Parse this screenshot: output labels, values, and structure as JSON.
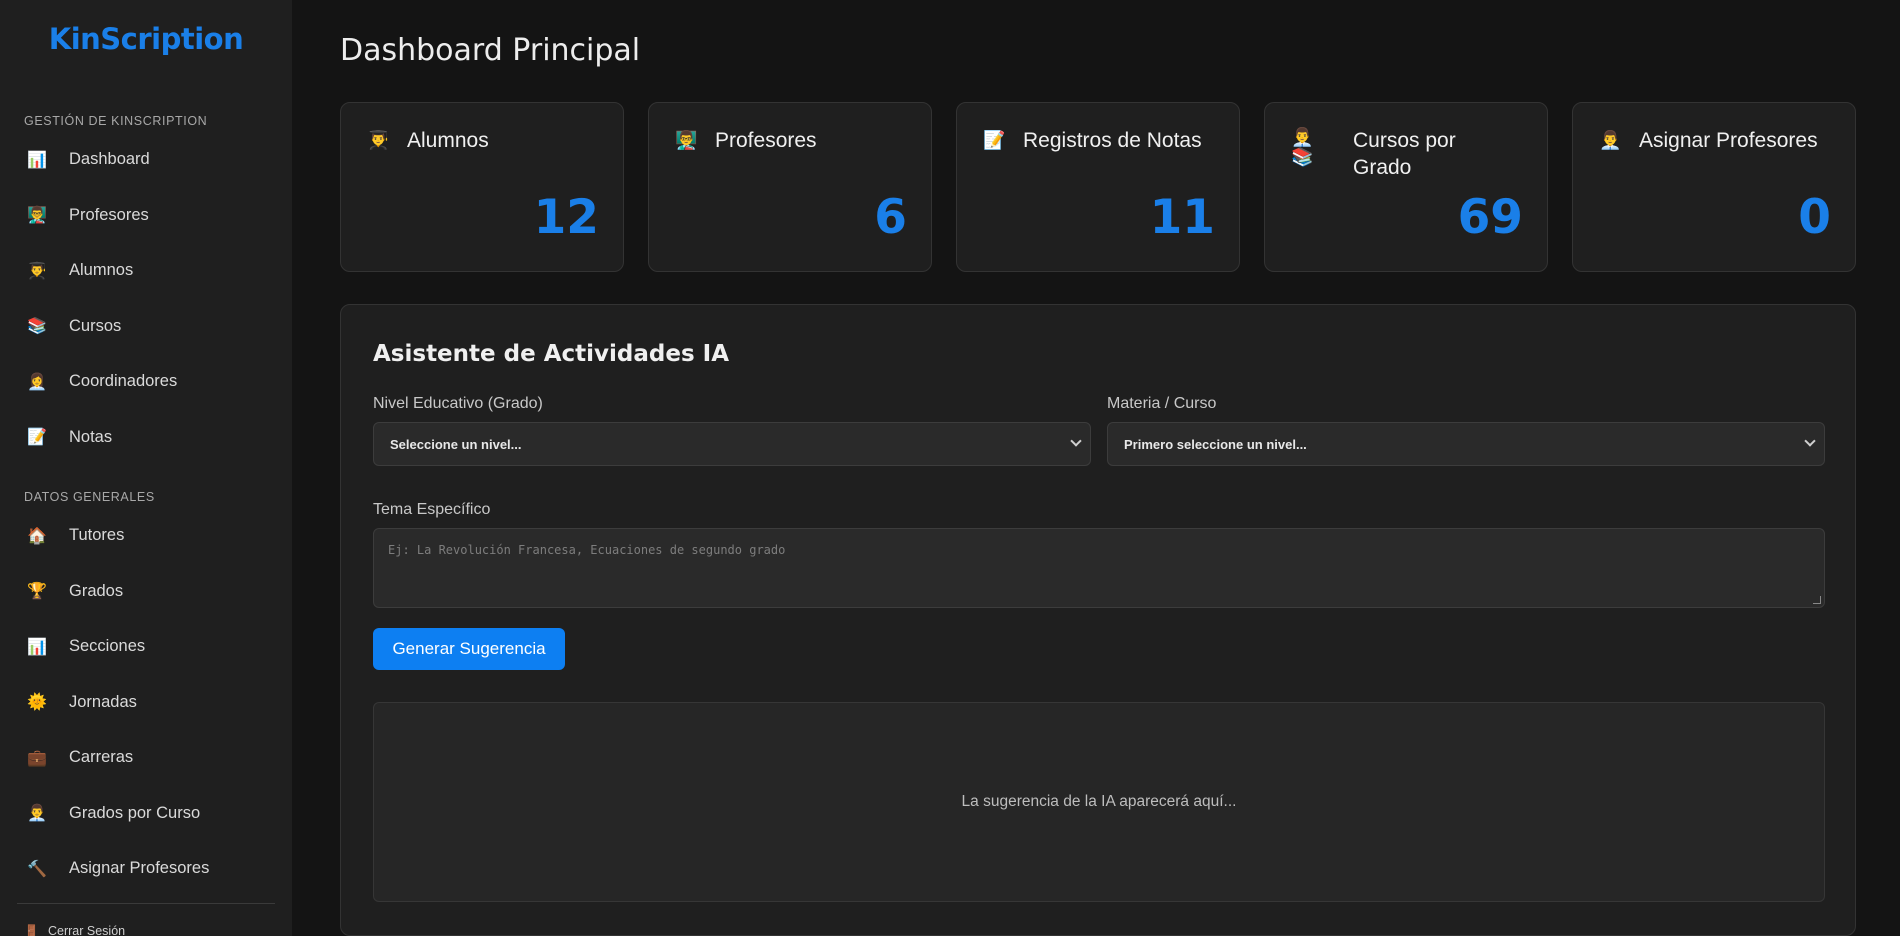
{
  "app": {
    "name": "KinScription",
    "accent": "#1a7fe8"
  },
  "sidebar": {
    "section1": "GESTIÓN DE KINSCRIPTION",
    "section2": "DATOS GENERALES",
    "items1": [
      {
        "label": "Dashboard",
        "icon": "📊"
      },
      {
        "label": "Profesores",
        "icon": "👨‍🏫"
      },
      {
        "label": "Alumnos",
        "icon": "👨‍🎓"
      },
      {
        "label": "Cursos",
        "icon": "📚"
      },
      {
        "label": "Coordinadores",
        "icon": "👩‍💼"
      },
      {
        "label": "Notas",
        "icon": "📝"
      }
    ],
    "items2": [
      {
        "label": "Tutores",
        "icon": "🏠"
      },
      {
        "label": "Grados",
        "icon": "🏆"
      },
      {
        "label": "Secciones",
        "icon": "📊"
      },
      {
        "label": "Jornadas",
        "icon": "🌞"
      },
      {
        "label": "Carreras",
        "icon": "💼"
      },
      {
        "label": "Grados por Curso",
        "icon": "👨‍💼"
      },
      {
        "label": "Asignar Profesores",
        "icon": "🔨"
      }
    ],
    "logout": {
      "label": "Cerrar Sesión",
      "icon": "🚪"
    }
  },
  "main": {
    "title": "Dashboard Principal",
    "cards": [
      {
        "label": "Alumnos",
        "value": "12",
        "icon": "👨‍🎓"
      },
      {
        "label": "Profesores",
        "value": "6",
        "icon": "👨‍🏫"
      },
      {
        "label": "Registros de Notas",
        "value": "11",
        "icon": "📝"
      },
      {
        "label": "Cursos por Grado",
        "value": "69",
        "icon": "👨‍💼",
        "icon2": "📚"
      },
      {
        "label": "Asignar Profesores",
        "value": "0",
        "icon": "👨‍💼"
      }
    ],
    "assistant": {
      "title": "Asistente de Actividades IA",
      "level_label": "Nivel Educativo (Grado)",
      "level_value": "Seleccione un nivel...",
      "subject_label": "Materia / Curso",
      "subject_value": "Primero seleccione un nivel...",
      "topic_label": "Tema Específico",
      "topic_placeholder": "Ej: La Revolución Francesa, Ecuaciones de segundo grado",
      "button_label": "Generar Sugerencia",
      "output_placeholder": "La sugerencia de la IA aparecerá aquí..."
    }
  }
}
